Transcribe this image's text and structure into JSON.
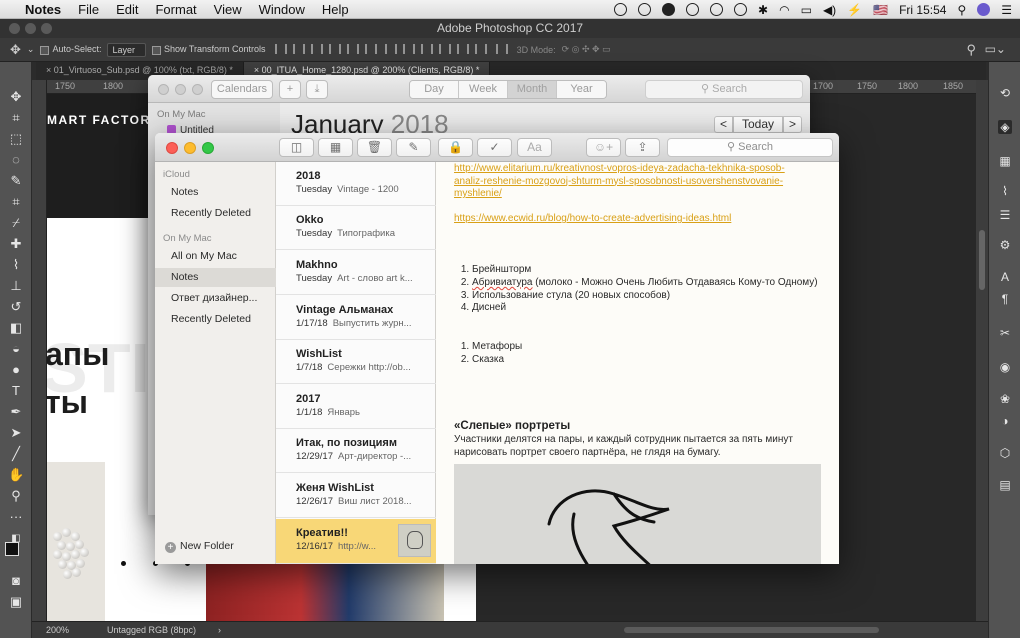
{
  "menubar": {
    "apple": "",
    "app": "Notes",
    "items": [
      "File",
      "Edit",
      "Format",
      "View",
      "Window",
      "Help"
    ],
    "battery": "⚡",
    "flag": "🇺🇸",
    "clock": "Fri 15:54"
  },
  "photoshop": {
    "title": "Adobe Photoshop CC 2017",
    "options": {
      "auto_select_label": "Auto-Select:",
      "auto_select_value": "Layer",
      "transform_label": "Show Transform Controls",
      "mode_3d": "3D Mode:"
    },
    "tabs": [
      "01_Virtuoso_Sub.psd @ 100% (txt, RGB/8) *",
      "00_ITUA_Home_1280.psd @ 200% (Clients, RGB/8) *"
    ],
    "ruler": [
      "1750",
      "1800",
      "1850",
      "1700",
      "1750",
      "1800",
      "1850"
    ],
    "canvas": {
      "brand": "MART FACTORY",
      "line1": "апы",
      "line2": "ты",
      "ghost": "STI"
    },
    "status": {
      "zoom": "200%",
      "profile": "Untagged RGB (8bpc)"
    }
  },
  "calendar": {
    "sidebar_header": "On My Mac",
    "calendars_button": "Calendars",
    "add_button": "+",
    "views": [
      "Day",
      "Week",
      "Month",
      "Year"
    ],
    "active_view": "Month",
    "search_placeholder": "Search",
    "calendar_item": "Untitled",
    "month": "January",
    "year": "2018",
    "today": "Today",
    "prev": "<",
    "next": ">"
  },
  "notes": {
    "search_placeholder": "Search",
    "folders": {
      "icloud_header": "iCloud",
      "icloud_items": [
        "Notes",
        "Recently Deleted"
      ],
      "mac_header": "On My Mac",
      "mac_items": [
        "All on My Mac",
        "Notes",
        "Ответ дизайнер...",
        "Recently Deleted"
      ],
      "selected": "Notes",
      "new_folder": "New Folder"
    },
    "list": [
      {
        "title": "2018",
        "date": "Tuesday",
        "preview": "Vintage - 1200"
      },
      {
        "title": "Okko",
        "date": "Tuesday",
        "preview": "Типографика"
      },
      {
        "title": "Makhno",
        "date": "Tuesday",
        "preview": "Art - слово art k..."
      },
      {
        "title": "Vintage Альманах",
        "date": "1/17/18",
        "preview": "Выпустить журн..."
      },
      {
        "title": "WishList",
        "date": "1/7/18",
        "preview": "Сережки http://ob..."
      },
      {
        "title": "2017",
        "date": "1/1/18",
        "preview": "Январь"
      },
      {
        "title": "Итак, по позициям",
        "date": "12/29/17",
        "preview": "Арт-директор -..."
      },
      {
        "title": "Женя WishList",
        "date": "12/26/17",
        "preview": "Виш лист 2018..."
      },
      {
        "title": "Креатив!!",
        "date": "12/16/17",
        "preview": "http://w..."
      }
    ],
    "body": {
      "link1_l1": "http://www.elitarium.ru/kreativnost-vopros-ideya-zadacha-tekhnika-sposob-",
      "link1_l2": "analiz-reshenie-mozgovoj-shturm-mysl-sposobnosti-usovershenstvovanie-",
      "link1_l3": "myshlenie/",
      "link2": "https://www.ecwid.ru/blog/how-to-create-advertising-ideas.html",
      "list1_item1": "Брейншторм",
      "list1_item2_word": "Абривиатура",
      "list1_item2_rest": " (молоко - Можно Очень Любить Отдаваясь Кому-то Одному)",
      "list1_item3": "Использование стула (20 новых способов)",
      "list1_item4": "Дисней",
      "list2": [
        "Метафоры",
        "Сказка"
      ],
      "heading": "«Слепые» портреты",
      "paragraph": "Участники делятся на пары, и каждый сотрудник пытается за пять минут нарисовать портрет своего партнёра, не глядя на бумагу."
    }
  },
  "colors": {
    "note_selected": "#f8d777",
    "link": "#d9a016",
    "ps_panel": "#535353"
  }
}
